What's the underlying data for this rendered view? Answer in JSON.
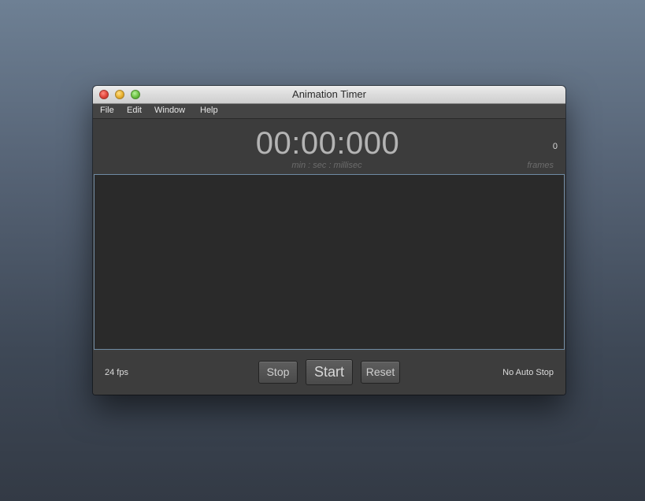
{
  "window": {
    "title": "Animation Timer"
  },
  "menu": {
    "items": [
      {
        "label": "File"
      },
      {
        "label": "Edit"
      },
      {
        "label": "Window"
      },
      {
        "label": "Help"
      }
    ]
  },
  "display": {
    "time": "00:00:000",
    "time_caption": "min : sec : millisec",
    "frame_count": "0",
    "frame_caption": "frames"
  },
  "controls": {
    "fps_label": "24 fps",
    "stop_label": "Stop",
    "start_label": "Start",
    "reset_label": "Reset",
    "auto_stop_label": "No Auto Stop"
  },
  "colors": {
    "canvas_border": "#6f8aa3",
    "window_background": "#3f3f3f"
  }
}
